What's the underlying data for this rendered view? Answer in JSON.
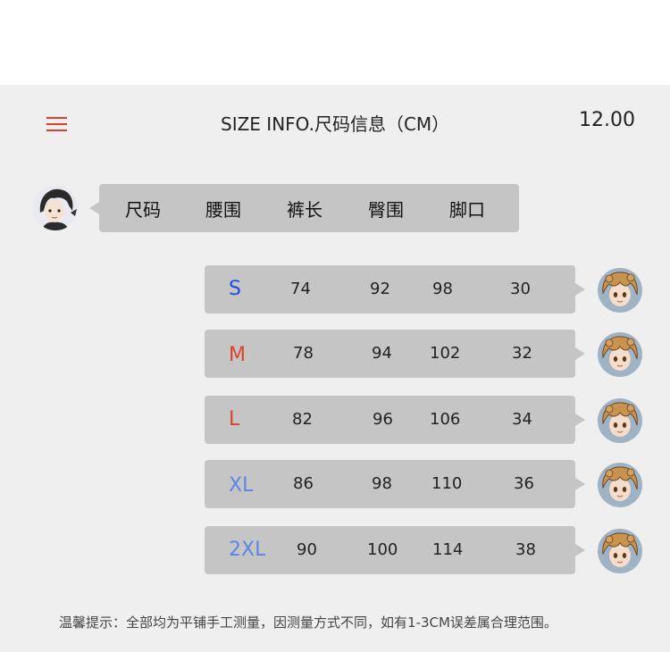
{
  "header": {
    "title": "SIZE INFO.尺码信息（CM）",
    "time": "12.00",
    "menu_icon": "hamburger-menu-icon",
    "accent_color": "#d9432b"
  },
  "columns": [
    "尺码",
    "腰围",
    "裤长",
    "臀围",
    "脚口"
  ],
  "rows": [
    {
      "size": "S",
      "color": "#1a4fe0",
      "waist": "74",
      "length": "92",
      "hip": "98",
      "hem": "30"
    },
    {
      "size": "M",
      "color": "#d9432b",
      "waist": "78",
      "length": "94",
      "hip": "102",
      "hem": "32"
    },
    {
      "size": "L",
      "color": "#d9432b",
      "waist": "82",
      "length": "96",
      "hip": "106",
      "hem": "34"
    },
    {
      "size": "XL",
      "color": "#5b86e5",
      "waist": "86",
      "length": "98",
      "hip": "110",
      "hem": "36"
    },
    {
      "size": "2XL",
      "color": "#5b86e5",
      "waist": "90",
      "length": "100",
      "hip": "114",
      "hem": "38"
    }
  ],
  "footer": {
    "note": "温馨提示：全部均为平铺手工测量，因测量方式不同，如有1-3CM误差属合理范围。"
  }
}
